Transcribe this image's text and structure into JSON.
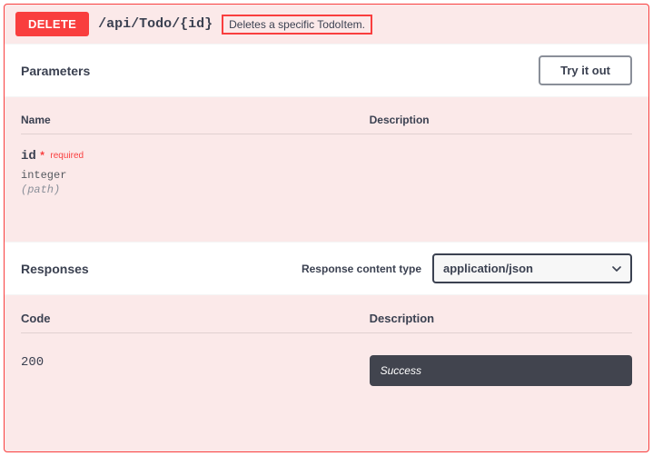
{
  "operation": {
    "method": "DELETE",
    "path": "/api/Todo/{id}",
    "summary": "Deletes a specific TodoItem."
  },
  "sections": {
    "parameters_label": "Parameters",
    "try_it_out_label": "Try it out",
    "responses_label": "Responses",
    "response_content_type_label": "Response content type"
  },
  "columns": {
    "name": "Name",
    "description": "Description",
    "code": "Code",
    "desc2": "Description"
  },
  "parameters": [
    {
      "name": "id",
      "required_marker": "*",
      "required_text": "required",
      "type": "integer",
      "in": "(path)"
    }
  ],
  "content_type_selected": "application/json",
  "responses": [
    {
      "code": "200",
      "description": "Success"
    }
  ]
}
